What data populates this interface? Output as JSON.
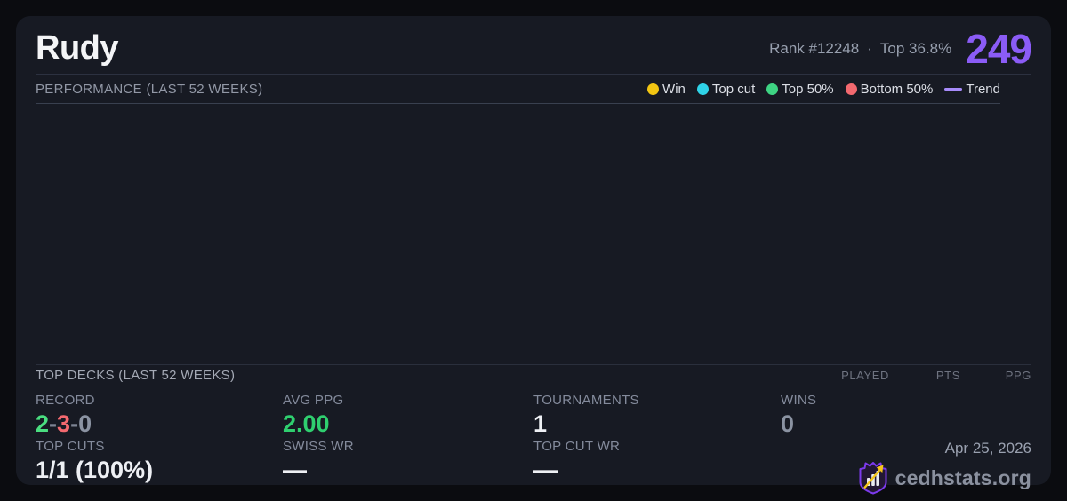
{
  "header": {
    "title": "Rudy",
    "rank": "Rank #12248",
    "separator": "·",
    "percentile": "Top 36.8%",
    "score": "249"
  },
  "performance": {
    "title": "PERFORMANCE (LAST 52 WEEKS)",
    "legend": [
      {
        "label": "Win",
        "color": "#f2c512"
      },
      {
        "label": "Top cut",
        "color": "#2fd3e8"
      },
      {
        "label": "Top 50%",
        "color": "#3ed483"
      },
      {
        "label": "Bottom 50%",
        "color": "#f3696f"
      }
    ],
    "trend_label": "Trend",
    "trend_color": "#a78bfa"
  },
  "top_decks": {
    "title": "TOP DECKS (LAST 52 WEEKS)",
    "columns": [
      "PLAYED",
      "PTS",
      "PPG"
    ]
  },
  "stats": {
    "record": {
      "label": "RECORD",
      "wins": "2",
      "losses": "3",
      "draws": "0",
      "separator": "-"
    },
    "avg_ppg": {
      "label": "AVG PPG",
      "value": "2.00"
    },
    "tournaments": {
      "label": "TOURNAMENTS",
      "value": "1"
    },
    "wins": {
      "label": "WINS",
      "value": "0"
    },
    "top_cuts": {
      "label": "TOP CUTS",
      "value": "1/1 (100%)"
    },
    "swiss_wr": {
      "label": "SWISS WR",
      "value": "—"
    },
    "top_cut_wr": {
      "label": "TOP CUT WR",
      "value": "—"
    }
  },
  "footer": {
    "date": "Apr 25, 2026",
    "site": "cedhstats.org"
  },
  "colors": {
    "accent": "#8b5cf6",
    "positive": "#4ade80",
    "negative": "#f3696f",
    "neutral": "#8b93a2",
    "ppg_green": "#2fcf6f"
  }
}
